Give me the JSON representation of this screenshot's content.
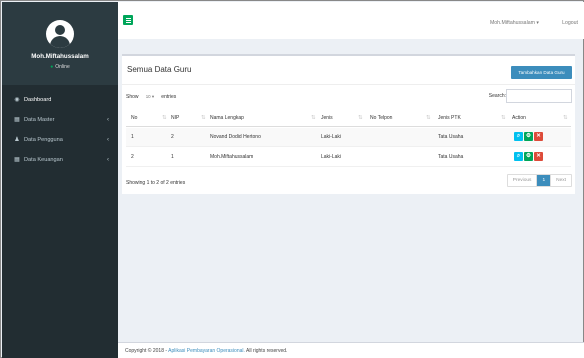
{
  "sidebar": {
    "user_name": "Moh.Miftahussalam",
    "user_status": "Online",
    "items": [
      {
        "label": "Dashboard",
        "icon": "dashboard-icon",
        "has_chevron": false
      },
      {
        "label": "Data Master",
        "icon": "table-icon",
        "has_chevron": true
      },
      {
        "label": "Data Pengguna",
        "icon": "user-icon",
        "has_chevron": true
      },
      {
        "label": "Data Keuangan",
        "icon": "table-icon",
        "has_chevron": true
      }
    ]
  },
  "header": {
    "user_label": "Moh.Miftahussalam",
    "logout_label": "Logout"
  },
  "box": {
    "title": "Semua Data Guru",
    "add_label": "Tambahkan Data Guru",
    "show_label": "Show",
    "entries_value": "10",
    "entries_label": "entries",
    "search_label": "Search:",
    "columns": [
      "No",
      "NIP",
      "Nama Lengkap",
      "Jenis",
      "No Telpon",
      "Jenis PTK",
      "Action"
    ],
    "rows": [
      {
        "no": "1",
        "nip": "2",
        "nama": "Novand Dodid Hertono",
        "jenis": "Laki-Laki",
        "telpon": "",
        "ptk": "Tata Usaha"
      },
      {
        "no": "2",
        "nip": "1",
        "nama": "Moh.Miftahussalam",
        "jenis": "Laki-Laki",
        "telpon": "",
        "ptk": "Tata Usaha"
      }
    ],
    "info": "Showing 1 to 2 of 2 entries",
    "pager": {
      "previous": "Previous",
      "current": "1",
      "next": "Next"
    }
  },
  "footer": {
    "prefix": "Copyright © 2018 -",
    "link": "Aplikasi Pembayaran Operasional.",
    "suffix": "All rights reserved."
  },
  "colors": {
    "sidebar": "#222d32",
    "accent_green": "#00a65a",
    "primary_blue": "#3c8dbc",
    "info_cyan": "#00c0ef",
    "danger_red": "#dd4b39"
  }
}
